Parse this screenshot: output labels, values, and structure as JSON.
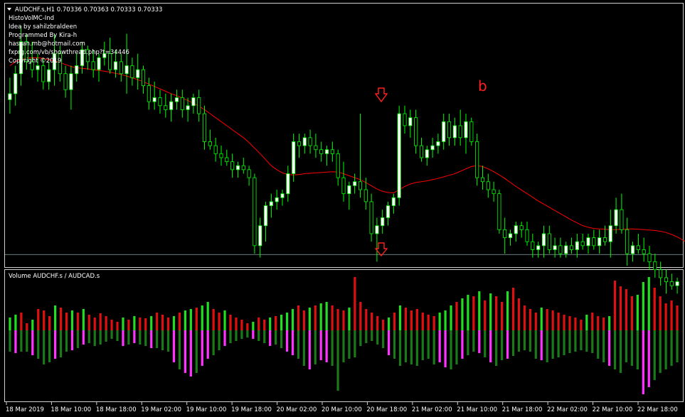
{
  "main_panel": {
    "title": "AUDCHF.s,H1  0.70336 0.70363 0.70333 0.70333",
    "info_lines": [
      "HistoVolMC-Ind",
      "Idea by sahilzbraldeen",
      "Programmed By Kira-h",
      "hassan.mb@hotmail.com",
      "fxprg.com/vb/showthread.php?t=34446",
      "Copyright ©2019"
    ],
    "annotation_b": "b",
    "arrow_color": "#ff2020",
    "bull_color": "#ffffff",
    "bear_color": "#000000",
    "candle_outline_color": "#00ff00",
    "ma_color": "#ff0000"
  },
  "sub_panel": {
    "title": "Volume AUDCHF.s / AUDCAD.s",
    "colors": {
      "up_green": "#22dd22",
      "up_red": "#e01010",
      "down_dark_green": "#1a7a1a",
      "down_magenta": "#ff33ff"
    }
  },
  "time_axis": {
    "labels": [
      "18 Mar 2019",
      "18 Mar 10:00",
      "18 Mar 18:00",
      "19 Mar 02:00",
      "19 Mar 10:00",
      "19 Mar 18:00",
      "20 Mar 02:00",
      "20 Mar 10:00",
      "20 Mar 18:00",
      "21 Mar 02:00",
      "21 Mar 10:00",
      "21 Mar 18:00",
      "22 Mar 02:00",
      "22 Mar 10:00",
      "22 Mar 18:00"
    ]
  },
  "chart_data": [
    {
      "type": "candlestick",
      "title": "AUDCHF.s,H1",
      "last_quote": {
        "open": 0.70336,
        "high": 0.70363,
        "low": 0.70333,
        "close": 0.70333
      },
      "candles": [
        [
          0.70715,
          0.7077,
          0.7068,
          0.7073
        ],
        [
          0.7073,
          0.708,
          0.707,
          0.7078
        ],
        [
          0.7078,
          0.709,
          0.7075,
          0.7086
        ],
        [
          0.7086,
          0.7088,
          0.7079,
          0.7081
        ],
        [
          0.7081,
          0.7086,
          0.7077,
          0.7079
        ],
        [
          0.7079,
          0.7083,
          0.7076,
          0.708
        ],
        [
          0.708,
          0.7082,
          0.7074,
          0.7076
        ],
        [
          0.7076,
          0.7081,
          0.7074,
          0.7079
        ],
        [
          0.7079,
          0.7088,
          0.7075,
          0.7083
        ],
        [
          0.7083,
          0.7085,
          0.7076,
          0.7078
        ],
        [
          0.7078,
          0.708,
          0.7072,
          0.7074
        ],
        [
          0.7074,
          0.708,
          0.7069,
          0.7078
        ],
        [
          0.7078,
          0.7083,
          0.7076,
          0.708
        ],
        [
          0.708,
          0.7086,
          0.7078,
          0.7084
        ],
        [
          0.7084,
          0.7085,
          0.7079,
          0.7081
        ],
        [
          0.7081,
          0.7084,
          0.7077,
          0.7079
        ],
        [
          0.7079,
          0.7083,
          0.7076,
          0.7082
        ],
        [
          0.7082,
          0.7086,
          0.708,
          0.7083
        ],
        [
          0.7083,
          0.7087,
          0.7078,
          0.7079
        ],
        [
          0.7079,
          0.7084,
          0.7077,
          0.7081
        ],
        [
          0.7081,
          0.7083,
          0.7076,
          0.7078
        ],
        [
          0.7078,
          0.7088,
          0.7073,
          0.708
        ],
        [
          0.708,
          0.7082,
          0.7075,
          0.7077
        ],
        [
          0.7077,
          0.7083,
          0.7074,
          0.7079
        ],
        [
          0.7079,
          0.708,
          0.7073,
          0.7075
        ],
        [
          0.7075,
          0.7077,
          0.7069,
          0.7071
        ],
        [
          0.7071,
          0.7076,
          0.7069,
          0.7072
        ],
        [
          0.7072,
          0.7074,
          0.7068,
          0.707
        ],
        [
          0.707,
          0.7073,
          0.7067,
          0.7069
        ],
        [
          0.7069,
          0.7073,
          0.7066,
          0.7071
        ],
        [
          0.7071,
          0.7074,
          0.7069,
          0.7072
        ],
        [
          0.7072,
          0.7074,
          0.7067,
          0.7069
        ],
        [
          0.7069,
          0.7072,
          0.7066,
          0.707
        ],
        [
          0.707,
          0.7073,
          0.7068,
          0.7072
        ],
        [
          0.7072,
          0.7074,
          0.7066,
          0.7068
        ],
        [
          0.7068,
          0.707,
          0.7059,
          0.7061
        ],
        [
          0.7061,
          0.7064,
          0.7059,
          0.706
        ],
        [
          0.706,
          0.7062,
          0.7056,
          0.7058
        ],
        [
          0.7058,
          0.706,
          0.7055,
          0.7057
        ],
        [
          0.7057,
          0.7059,
          0.7055,
          0.7056
        ],
        [
          0.7056,
          0.7058,
          0.7052,
          0.7054
        ],
        [
          0.7054,
          0.7056,
          0.7052,
          0.7055
        ],
        [
          0.7055,
          0.7057,
          0.7053,
          0.7054
        ],
        [
          0.7054,
          0.7055,
          0.705,
          0.7052
        ],
        [
          0.7052,
          0.7053,
          0.7033,
          0.7035
        ],
        [
          0.7035,
          0.7042,
          0.7032,
          0.704
        ],
        [
          0.704,
          0.7046,
          0.7036,
          0.7045
        ],
        [
          0.7045,
          0.7048,
          0.7042,
          0.7046
        ],
        [
          0.7046,
          0.7049,
          0.7044,
          0.7047
        ],
        [
          0.7047,
          0.7049,
          0.7045,
          0.7048
        ],
        [
          0.7048,
          0.7055,
          0.7046,
          0.7053
        ],
        [
          0.7053,
          0.7063,
          0.7051,
          0.7061
        ],
        [
          0.7061,
          0.7063,
          0.7057,
          0.706
        ],
        [
          0.706,
          0.7063,
          0.7058,
          0.7062
        ],
        [
          0.7062,
          0.7064,
          0.7058,
          0.706
        ],
        [
          0.706,
          0.7063,
          0.7057,
          0.7059
        ],
        [
          0.7059,
          0.7061,
          0.7056,
          0.7058
        ],
        [
          0.7058,
          0.706,
          0.7055,
          0.7059
        ],
        [
          0.7059,
          0.7061,
          0.7056,
          0.7058
        ],
        [
          0.7058,
          0.7059,
          0.705,
          0.7052
        ],
        [
          0.7052,
          0.7056,
          0.7046,
          0.7048
        ],
        [
          0.7048,
          0.7051,
          0.7044,
          0.705
        ],
        [
          0.705,
          0.7053,
          0.7048,
          0.7051
        ],
        [
          0.7051,
          0.7068,
          0.7047,
          0.7049
        ],
        [
          0.7049,
          0.7052,
          0.7044,
          0.7046
        ],
        [
          0.7046,
          0.7048,
          0.7036,
          0.7038
        ],
        [
          0.7038,
          0.7042,
          0.7031,
          0.704
        ],
        [
          0.704,
          0.7044,
          0.7038,
          0.7042
        ],
        [
          0.7042,
          0.7046,
          0.704,
          0.7045
        ],
        [
          0.7045,
          0.7048,
          0.7043,
          0.7047
        ],
        [
          0.7047,
          0.707,
          0.7045,
          0.7068
        ],
        [
          0.7068,
          0.707,
          0.7063,
          0.7065
        ],
        [
          0.7065,
          0.7069,
          0.7062,
          0.7067
        ],
        [
          0.7067,
          0.7069,
          0.7058,
          0.706
        ],
        [
          0.706,
          0.7062,
          0.7056,
          0.7057
        ],
        [
          0.7057,
          0.706,
          0.7055,
          0.7059
        ],
        [
          0.7059,
          0.7062,
          0.7057,
          0.706
        ],
        [
          0.706,
          0.7063,
          0.7058,
          0.7061
        ],
        [
          0.7061,
          0.7068,
          0.7059,
          0.7066
        ],
        [
          0.7066,
          0.7068,
          0.706,
          0.7062
        ],
        [
          0.7062,
          0.7067,
          0.706,
          0.7065
        ],
        [
          0.7065,
          0.7069,
          0.706,
          0.7062
        ],
        [
          0.7062,
          0.7068,
          0.7058,
          0.7066
        ],
        [
          0.7066,
          0.7067,
          0.706,
          0.7061
        ],
        [
          0.7061,
          0.7063,
          0.705,
          0.7052
        ],
        [
          0.7052,
          0.7055,
          0.7049,
          0.7051
        ],
        [
          0.7051,
          0.7053,
          0.7047,
          0.7049
        ],
        [
          0.7049,
          0.7051,
          0.7046,
          0.7048
        ],
        [
          0.7048,
          0.7049,
          0.7038,
          0.7039
        ],
        [
          0.7039,
          0.7042,
          0.7033,
          0.7037
        ],
        [
          0.7037,
          0.7039,
          0.7035,
          0.7038
        ],
        [
          0.7038,
          0.7041,
          0.7036,
          0.704
        ],
        [
          0.704,
          0.7041,
          0.7037,
          0.7039
        ],
        [
          0.7039,
          0.7041,
          0.7035,
          0.7036
        ],
        [
          0.7036,
          0.7038,
          0.7032,
          0.7034
        ],
        [
          0.7034,
          0.7036,
          0.7032,
          0.7035
        ],
        [
          0.7035,
          0.704,
          0.7032,
          0.7038
        ],
        [
          0.7038,
          0.704,
          0.7033,
          0.7034
        ],
        [
          0.7034,
          0.7037,
          0.7032,
          0.7035
        ],
        [
          0.7035,
          0.7037,
          0.7032,
          0.7033
        ],
        [
          0.7033,
          0.7036,
          0.7032,
          0.7035
        ],
        [
          0.7035,
          0.7037,
          0.7033,
          0.7034
        ],
        [
          0.7034,
          0.7038,
          0.7032,
          0.7036
        ],
        [
          0.7036,
          0.7038,
          0.7034,
          0.7035
        ],
        [
          0.7035,
          0.7038,
          0.7033,
          0.7037
        ],
        [
          0.7037,
          0.7039,
          0.7034,
          0.7035
        ],
        [
          0.7035,
          0.7039,
          0.7033,
          0.7037
        ],
        [
          0.7037,
          0.704,
          0.7035,
          0.7036
        ],
        [
          0.7036,
          0.7044,
          0.7032,
          0.704
        ],
        [
          0.704,
          0.7047,
          0.7038,
          0.7044
        ],
        [
          0.7044,
          0.7048,
          0.7038,
          0.7039
        ],
        [
          0.7039,
          0.7042,
          0.703,
          0.7033
        ],
        [
          0.7033,
          0.7036,
          0.7031,
          0.7035
        ],
        [
          0.7035,
          0.7038,
          0.7033,
          0.7034
        ],
        [
          0.7034,
          0.7037,
          0.7031,
          0.7033
        ],
        [
          0.7033,
          0.7035,
          0.7029,
          0.7031
        ],
        [
          0.7031,
          0.7033,
          0.7027,
          0.7029
        ],
        [
          0.7029,
          0.7031,
          0.7025,
          0.7027
        ],
        [
          0.7027,
          0.7029,
          0.7023,
          0.7026
        ],
        [
          0.7026,
          0.7028,
          0.7024,
          0.7025
        ],
        [
          0.7025,
          0.7027,
          0.7023,
          0.7026
        ]
      ],
      "moving_average": [
        0.708,
        0.7081,
        0.70815,
        0.70818,
        0.7082,
        0.7082,
        0.70818,
        0.70815,
        0.70812,
        0.70808,
        0.70803,
        0.70798,
        0.70795,
        0.70793,
        0.70792,
        0.7079,
        0.70788,
        0.70786,
        0.70784,
        0.70781,
        0.70778,
        0.70774,
        0.7077,
        0.70765,
        0.7076,
        0.70754,
        0.70748,
        0.70742,
        0.70736,
        0.7073,
        0.70725,
        0.70719,
        0.70713,
        0.70706,
        0.70699,
        0.7069,
        0.7068,
        0.7067,
        0.7066,
        0.7065,
        0.7064,
        0.7063,
        0.7062,
        0.70608,
        0.70594,
        0.7058,
        0.70565,
        0.7055,
        0.7054,
        0.70532,
        0.70528,
        0.70527,
        0.70528,
        0.7053,
        0.70531,
        0.70532,
        0.70533,
        0.70534,
        0.70535,
        0.70534,
        0.7053,
        0.70525,
        0.7052,
        0.70515,
        0.70508,
        0.705,
        0.70492,
        0.70486,
        0.70483,
        0.70482,
        0.7049,
        0.70498,
        0.70504,
        0.70508,
        0.7051,
        0.70512,
        0.70515,
        0.70518,
        0.70522,
        0.70526,
        0.7053,
        0.70536,
        0.70542,
        0.70548,
        0.7055,
        0.70548,
        0.70542,
        0.70535,
        0.70527,
        0.70518,
        0.70508,
        0.70498,
        0.70489,
        0.7048,
        0.70471,
        0.70462,
        0.70454,
        0.70446,
        0.70438,
        0.7043,
        0.70422,
        0.70414,
        0.70407,
        0.704,
        0.70396,
        0.70393,
        0.70392,
        0.70391,
        0.7039,
        0.7039,
        0.70391,
        0.70392,
        0.70392,
        0.70391,
        0.7039,
        0.70389,
        0.70388,
        0.70386,
        0.70383,
        0.70378,
        0.70372,
        0.70364,
        0.70356
      ],
      "horizontal_line": 0.70328,
      "ylim": [
        0.703,
        0.7095
      ]
    },
    {
      "type": "bar",
      "title": "Volume AUDCHF.s / AUDCAD.s",
      "series": [
        {
          "values_up": [
            18,
            22,
            25,
            10,
            15,
            30,
            28,
            20,
            35,
            32,
            25,
            28,
            25,
            30,
            22,
            18,
            24,
            20,
            15,
            12,
            18,
            15,
            20,
            18,
            17,
            20,
            25,
            22,
            18,
            20,
            25,
            28,
            30,
            32,
            35,
            40,
            30,
            25,
            28,
            22,
            18,
            15,
            10,
            12,
            18,
            15,
            18,
            20,
            22,
            25,
            30,
            35,
            28,
            32,
            35,
            38,
            40,
            35,
            30,
            28,
            32,
            75,
            40,
            30,
            25,
            20,
            15,
            18,
            25,
            35,
            32,
            28,
            30,
            25,
            22,
            20,
            25,
            28,
            35,
            40,
            45,
            50,
            48,
            55,
            42,
            52,
            48,
            40,
            55,
            60,
            45,
            35,
            30,
            25,
            32,
            30,
            28,
            25,
            22,
            20,
            18,
            15,
            22,
            25,
            20,
            18,
            20,
            70,
            62,
            58,
            48,
            50,
            68,
            75,
            60,
            48,
            38,
            42,
            35
          ],
          "values_down": [
            30,
            32,
            30,
            30,
            35,
            40,
            48,
            45,
            40,
            38,
            30,
            28,
            25,
            20,
            18,
            22,
            20,
            16,
            12,
            15,
            22,
            20,
            18,
            20,
            22,
            25,
            25,
            28,
            30,
            45,
            55,
            60,
            65,
            60,
            50,
            40,
            35,
            28,
            22,
            18,
            15,
            12,
            10,
            12,
            15,
            18,
            22,
            20,
            25,
            30,
            35,
            40,
            50,
            55,
            48,
            42,
            45,
            50,
            85,
            45,
            40,
            38,
            22,
            18,
            15,
            20,
            25,
            35,
            40,
            50,
            45,
            48,
            50,
            42,
            40,
            48,
            45,
            52,
            55,
            48,
            40,
            35,
            30,
            32,
            38,
            45,
            50,
            42,
            40,
            36,
            30,
            28,
            30,
            40,
            42,
            45,
            40,
            38,
            35,
            32,
            30,
            28,
            30,
            32,
            40,
            45,
            50,
            55,
            60,
            45,
            50,
            55,
            90,
            80,
            70,
            60,
            55,
            50,
            45
          ]
        }
      ]
    }
  ]
}
